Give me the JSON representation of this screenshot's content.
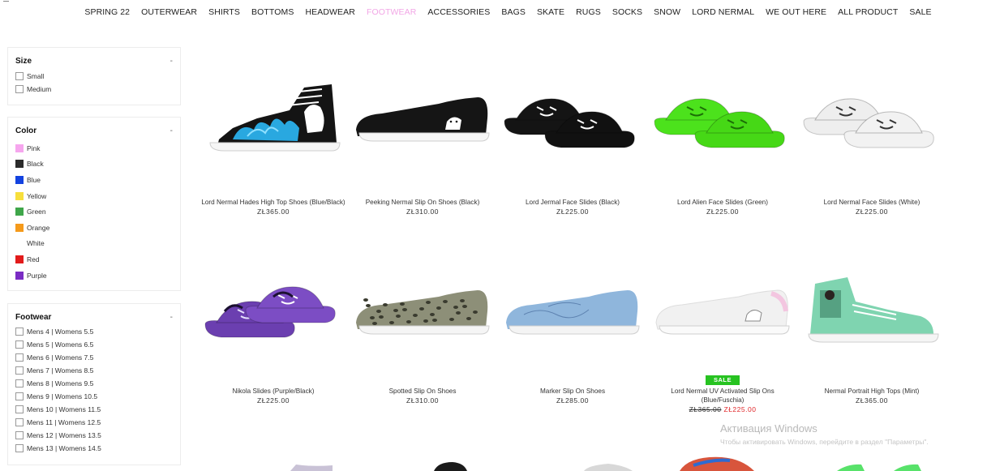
{
  "nav": {
    "items": [
      "SPRING 22",
      "OUTERWEAR",
      "SHIRTS",
      "BOTTOMS",
      "HEADWEAR",
      "FOOTWEAR",
      "ACCESSORIES",
      "BAGS",
      "SKATE",
      "RUGS",
      "SOCKS",
      "SNOW",
      "LORD NERMAL",
      "WE OUT HERE",
      "ALL PRODUCT",
      "SALE"
    ],
    "active": "FOOTWEAR"
  },
  "filters": {
    "size": {
      "title": "Size",
      "toggle": "-",
      "options": [
        "Small",
        "Medium"
      ]
    },
    "color": {
      "title": "Color",
      "toggle": "-",
      "options": [
        {
          "label": "Pink",
          "hex": "#f6a6ee"
        },
        {
          "label": "Black",
          "hex": "#2b2b2b"
        },
        {
          "label": "Blue",
          "hex": "#1343e0"
        },
        {
          "label": "Yellow",
          "hex": "#f7df3c"
        },
        {
          "label": "Green",
          "hex": "#3fa64a"
        },
        {
          "label": "Orange",
          "hex": "#f59a1b"
        },
        {
          "label": "White",
          "hex": "#ffffff"
        },
        {
          "label": "Red",
          "hex": "#e21b1b"
        },
        {
          "label": "Purple",
          "hex": "#7a2cc4"
        }
      ]
    },
    "footwear": {
      "title": "Footwear",
      "toggle": "-",
      "options": [
        "Mens 4 | Womens 5.5",
        "Mens 5 | Womens 6.5",
        "Mens 6 | Womens 7.5",
        "Mens 7 | Womens 8.5",
        "Mens 8 | Womens 9.5",
        "Mens 9 | Womens 10.5",
        "Mens 10 | Womens 11.5",
        "Mens 11 | Womens 12.5",
        "Mens 12 | Womens 13.5",
        "Mens 13 | Womens 14.5"
      ]
    }
  },
  "products": [
    {
      "name": "Lord Nermal Hades High Top Shoes (Blue/Black)",
      "price": "ZŁ365.00",
      "shoe": "hightop-flames"
    },
    {
      "name": "Peeking Nermal Slip On Shoes (Black)",
      "price": "ZŁ310.00",
      "shoe": "slipon-black"
    },
    {
      "name": "Lord Jermal Face Slides (Black)",
      "price": "ZŁ225.00",
      "shoe": "slides-black"
    },
    {
      "name": "Lord Alien Face Slides (Green)",
      "price": "ZŁ225.00",
      "shoe": "slides-green"
    },
    {
      "name": "Lord Nermal Face Slides (White)",
      "price": "ZŁ225.00",
      "shoe": "slides-white"
    },
    {
      "name": "Nikola Slides (Purple/Black)",
      "price": "ZŁ225.00",
      "shoe": "slides-purple"
    },
    {
      "name": "Spotted Slip On Shoes",
      "price": "ZŁ310.00",
      "shoe": "slipon-leopard"
    },
    {
      "name": "Marker Slip On Shoes",
      "price": "ZŁ285.00",
      "shoe": "slipon-blue"
    },
    {
      "name": "Lord Nermal UV Activated Slip Ons (Blue/Fuschia)",
      "price_old": "ZŁ365.00",
      "price_new": "ZŁ225.00",
      "badge": "SALE",
      "shoe": "slipon-white"
    },
    {
      "name": "Nermal Portrait High Tops (Mint)",
      "price": "ZŁ365.00",
      "shoe": "hightop-mint"
    }
  ],
  "watermark": {
    "title": "Активация Windows",
    "subtitle": "Чтобы активировать Windows, перейдите в раздел \"Параметры\"."
  }
}
